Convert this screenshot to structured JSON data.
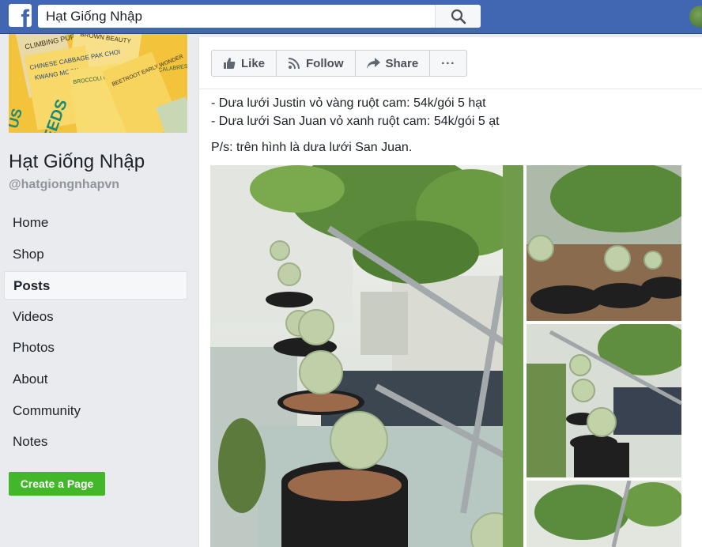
{
  "search": {
    "value": "Hạt Giống Nhập"
  },
  "page": {
    "name": "Hạt Giống Nhập",
    "handle": "@hatgiongnhapvn"
  },
  "nav": {
    "items": [
      {
        "label": "Home"
      },
      {
        "label": "Shop"
      },
      {
        "label": "Posts",
        "active": true
      },
      {
        "label": "Videos"
      },
      {
        "label": "Photos"
      },
      {
        "label": "About"
      },
      {
        "label": "Community"
      },
      {
        "label": "Notes"
      }
    ]
  },
  "create_page_label": "Create a Page",
  "actions": {
    "like": "Like",
    "follow": "Follow",
    "share": "Share",
    "more": "···"
  },
  "post": {
    "line1": "- Dưa lưới Justin vỏ vàng ruột cam: 54k/gói 5 hạt",
    "line2": "- Dưa lưới San Juan vỏ xanh ruột cam: 54k/gói 5 ạt",
    "ps": "P/s: trên hình là dưa lưới San Juan."
  },
  "cover_texts": {
    "purple": "CLIMBING PURPLE",
    "brown_beauty": "BROWN BEAUTY",
    "chinese_cabbage": "CHINESE CABBAGE PAK CHOI",
    "kwang_moon": "KWANG MOON",
    "broccoli": "BROCCOLI GREEN SPROUTING CALABRESE",
    "beetroot": "BEETROOT EARLY WONDER",
    "seeds": "SEEDS",
    "us": "US"
  },
  "colors": {
    "brand": "#4267b2",
    "create": "#42b72a",
    "cover": "#f3c53a"
  },
  "icons": [
    "facebook-logo-icon",
    "search-icon",
    "thumbs-up-icon",
    "rss-icon",
    "share-arrow-icon"
  ]
}
